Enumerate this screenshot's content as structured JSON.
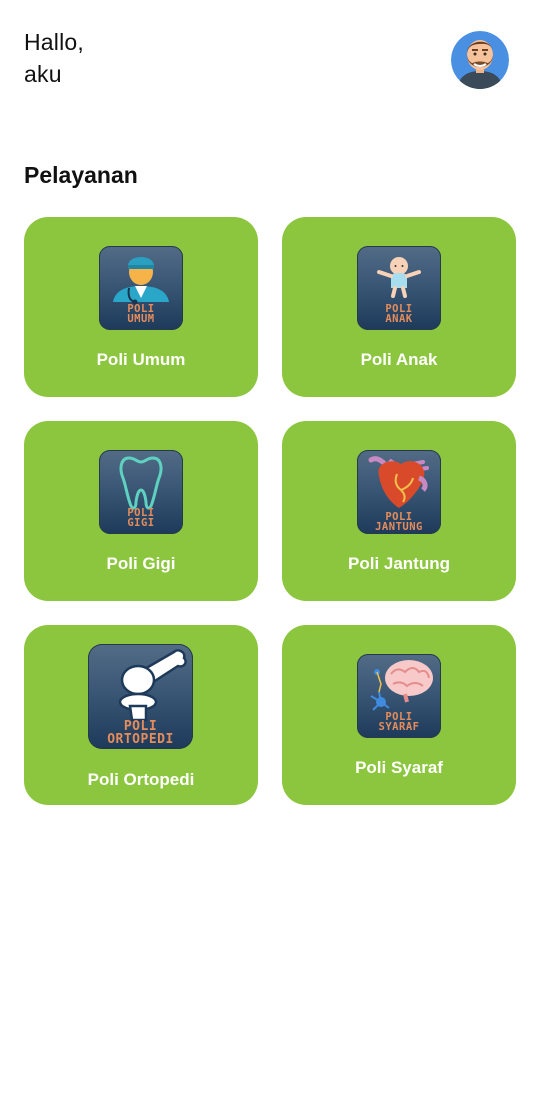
{
  "header": {
    "greeting_line1": "Hallo,",
    "greeting_line2": "aku",
    "avatar_icon": "man-avatar-icon"
  },
  "section": {
    "title": "Pelayanan"
  },
  "services": [
    {
      "label": "Poli Umum",
      "icon_text": [
        "POLI",
        "UMUM"
      ],
      "icon": "doctor-icon"
    },
    {
      "label": "Poli Anak",
      "icon_text": [
        "POLI",
        "ANAK"
      ],
      "icon": "baby-icon"
    },
    {
      "label": "Poli Gigi",
      "icon_text": [
        "POLI",
        "GIGI"
      ],
      "icon": "tooth-icon"
    },
    {
      "label": "Poli Jantung",
      "icon_text": [
        "POLI",
        "JANTUNG"
      ],
      "icon": "heart-icon"
    },
    {
      "label": "Poli Ortopedi",
      "icon_text": [
        "POLI",
        "ORTOPEDI"
      ],
      "icon": "bone-joint-icon"
    },
    {
      "label": "Poli Syaraf",
      "icon_text": [
        "POLI",
        "SYARAF"
      ],
      "icon": "brain-icon"
    }
  ],
  "colors": {
    "card_background": "#8cc63f",
    "card_text": "#ffffff",
    "icon_tile": "#3a5776",
    "icon_text": "#e58c5b",
    "avatar_background": "#4a90e2"
  }
}
